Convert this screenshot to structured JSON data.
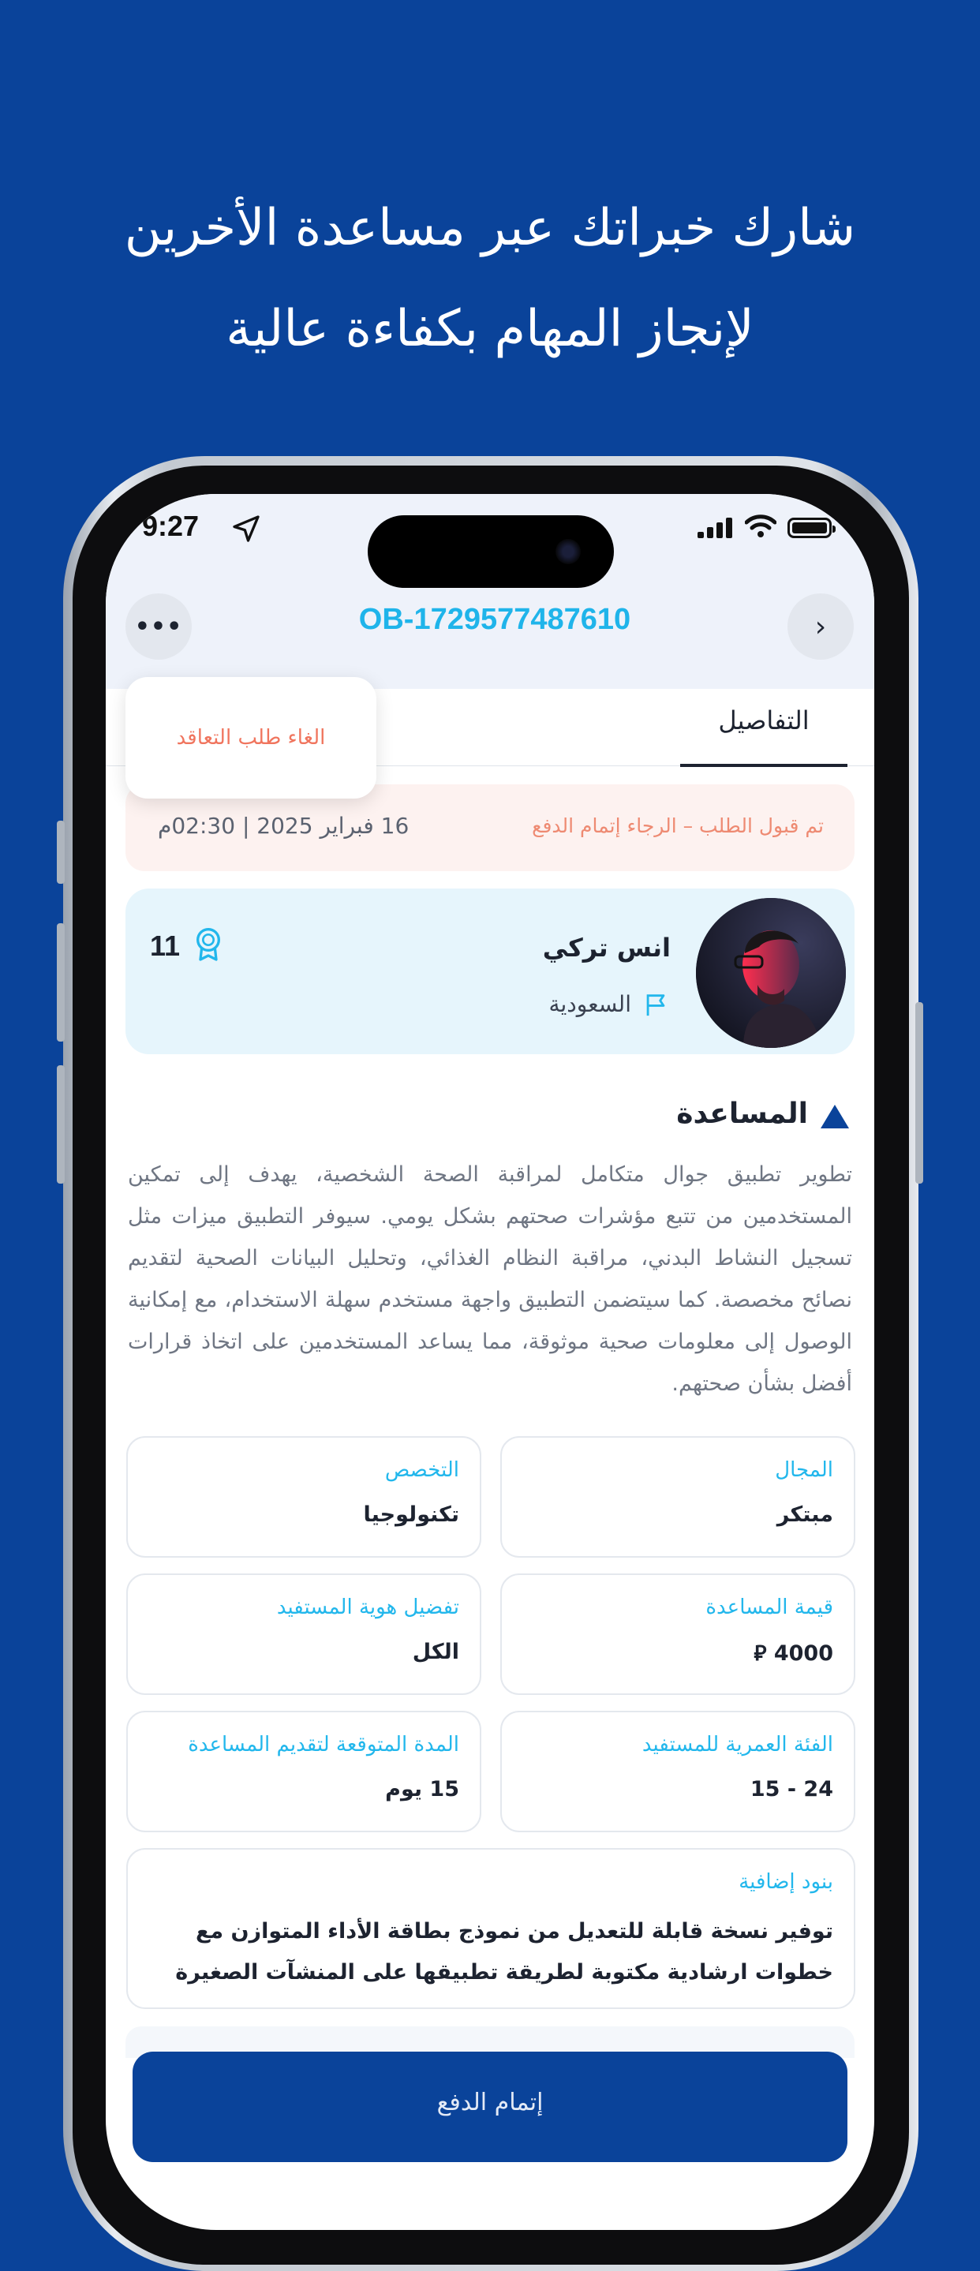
{
  "headline": {
    "line1": "شارك خبراتك عبر مساعدة الأخرين",
    "line2": "لإنجاز المهام بكفاءة عالية"
  },
  "status_bar": {
    "time": "9:27",
    "location_icon": "location-arrow-icon",
    "signal_icon": "cellular-signal-icon",
    "wifi_icon": "wifi-icon",
    "battery_icon": "battery-icon"
  },
  "header": {
    "order_id": "OB-1729577487610",
    "more_icon": "more-dots-icon",
    "more_label": "•••",
    "back_icon": "chevron-right-icon",
    "back_label": "›"
  },
  "tabs": {
    "details": "التفاصيل"
  },
  "menu": {
    "cancel_contract": "الغاء طلب التعاقد"
  },
  "status": {
    "message": "تم قبول الطلب – الرجاء إتمام الدفع",
    "date": "16 فبراير 2025  |  02:30م"
  },
  "user": {
    "name": "انس تركي",
    "country": "السعودية",
    "rank": "11",
    "flag_icon": "flag-icon",
    "rank_icon": "badge-icon"
  },
  "assistance": {
    "title": "المساعدة",
    "title_icon": "triangle-icon",
    "description": "تطوير تطبيق جوال متكامل لمراقبة الصحة الشخصية، يهدف إلى تمكين المستخدمين من تتبع مؤشرات صحتهم بشكل يومي. سيوفر التطبيق ميزات مثل تسجيل النشاط البدني، مراقبة النظام الغذائي، وتحليل البيانات الصحية لتقديم نصائح مخصصة. كما سيتضمن التطبيق واجهة مستخدم سهلة الاستخدام، مع إمكانية الوصول إلى معلومات صحية موثوقة، مما يساعد المستخدمين على اتخاذ قرارات أفضل بشأن صحتهم."
  },
  "info_cards": {
    "field": {
      "label": "المجال",
      "value": "مبتكر"
    },
    "specialty": {
      "label": "التخصص",
      "value": "تكنولوجيا"
    },
    "assistance_value": {
      "label": "قيمة المساعدة",
      "value": "4000 ⃁"
    },
    "beneficiary_identity": {
      "label": "تفضيل هوية المستفيد",
      "value": "الكل"
    },
    "age_group": {
      "label": "الفئة العمرية للمستفيد",
      "value": "15 - 24"
    },
    "duration": {
      "label": "المدة المتوقعة لتقديم المساعدة",
      "value": "15 يوم"
    },
    "extra_terms": {
      "label": "بنود إضافية",
      "value": "توفير نسخة قابلة للتعديل من نموذج بطاقة الأداء المتوازن مع خطوات ارشادية مكتوبة لطريقة تطبيقها على المنشآت الصغيرة"
    }
  },
  "actions": {
    "pay": "إتمام الدفع"
  },
  "colors": {
    "background": "#0a439a",
    "accent_cyan": "#22b7ec",
    "cancel_red": "#f0755e",
    "card_blue": "#e6f5fc"
  }
}
